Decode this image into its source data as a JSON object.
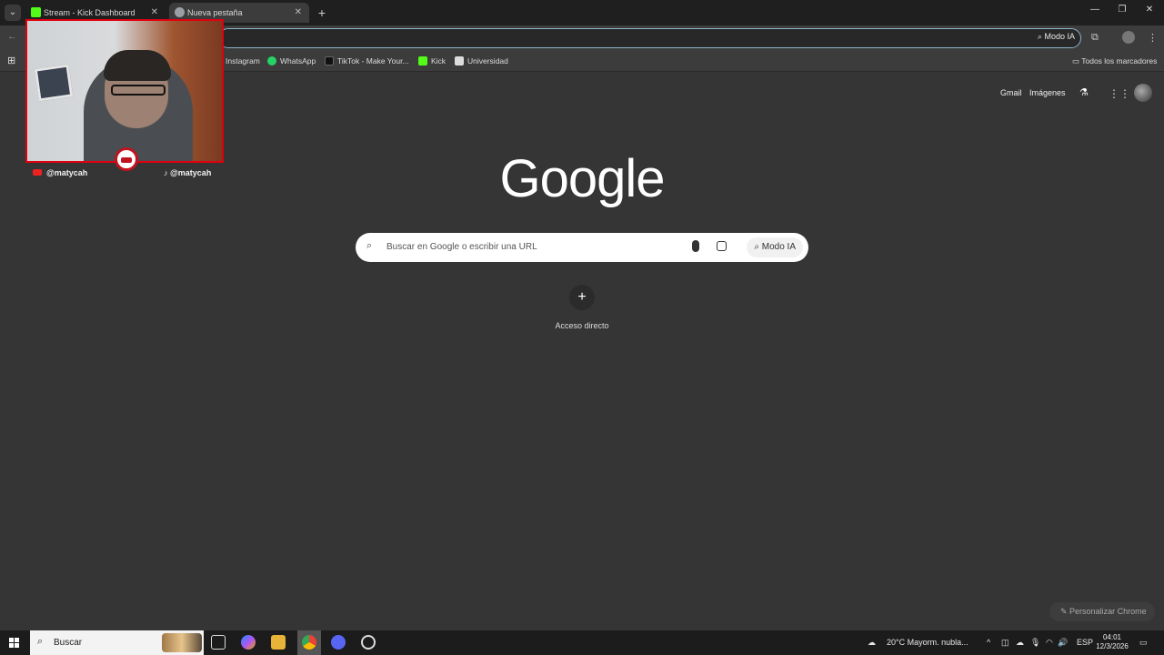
{
  "tabs": [
    {
      "title": "Stream - Kick Dashboard",
      "favicon_color": "#53fc18"
    },
    {
      "title": "Nueva pestaña",
      "favicon_color": "#9aa0a6"
    }
  ],
  "omnibox": {
    "ai_mode_label": "Modo IA"
  },
  "bookmarks": {
    "items": [
      {
        "label": "Instagram",
        "icon": "instagram-icon"
      },
      {
        "label": "WhatsApp",
        "icon": "whatsapp-icon"
      },
      {
        "label": "TikTok - Make Your...",
        "icon": "tiktok-icon"
      },
      {
        "label": "Kick",
        "icon": "kick-icon"
      },
      {
        "label": "Universidad",
        "icon": "doc-icon"
      }
    ],
    "all_bookmarks": "Todos los marcadores"
  },
  "webcam": {
    "youtube_handle": "@matycah",
    "tiktok_handle": "@matycah"
  },
  "google": {
    "gmail": "Gmail",
    "images": "Imágenes",
    "logo": "Google",
    "search_placeholder": "Buscar en Google o escribir una URL",
    "ai_mode": "Modo IA",
    "shortcut_label": "Acceso directo",
    "customize": "Personalizar Chrome"
  },
  "taskbar": {
    "search_label": "Buscar",
    "weather": "20°C  Mayorm. nubla...",
    "language": "ESP",
    "time": "04:01",
    "date": "12/3/2026"
  },
  "colors": {
    "accent": "#8ab4c8",
    "webcam_border": "#e00010",
    "kick_green": "#53fc18"
  }
}
